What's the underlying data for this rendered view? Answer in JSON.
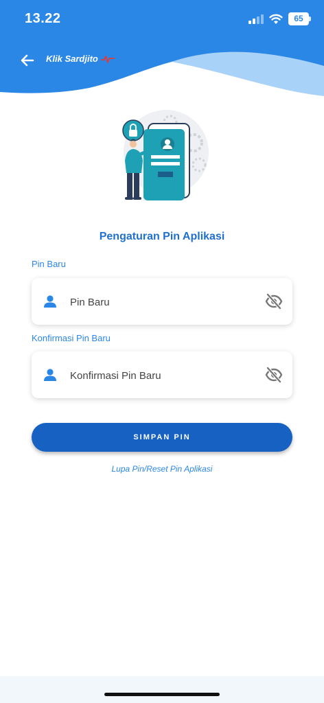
{
  "status_bar": {
    "time": "13.22",
    "battery": "65"
  },
  "header": {
    "brand": "Klik Sardjito"
  },
  "main": {
    "title": "Pengaturan Pin Aplikasi"
  },
  "form": {
    "pin_label": "Pin Baru",
    "pin_placeholder": "Pin Baru",
    "confirm_label": "Konfirmasi Pin Baru",
    "confirm_placeholder": "Konfirmasi Pin Baru",
    "save_label": "SIMPAN PIN",
    "forgot_label": "Lupa Pin/Reset Pin Aplikasi"
  },
  "icons": {
    "back": "arrow-left-icon",
    "user": "user-icon",
    "toggle_visibility": "eye-off-icon",
    "signal": "signal-icon",
    "wifi": "wifi-icon",
    "battery": "battery-icon"
  },
  "colors": {
    "header_blue": "#2b87e6",
    "title_blue": "#1f6fcf",
    "button_blue": "#1661c2",
    "label_blue": "#2b87e6"
  }
}
